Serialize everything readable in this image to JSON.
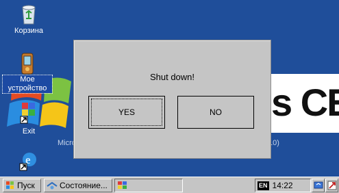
{
  "desktop": {
    "icons": [
      {
        "label": "Корзина"
      },
      {
        "label": "Мое устройство"
      },
      {
        "label": "Exit"
      },
      {
        "label": ""
      }
    ],
    "wallpaper": {
      "ce_text": "s CE",
      "ms_text": "Micro",
      "ms_tail": "10)"
    }
  },
  "dialog": {
    "message": "Shut down!",
    "yes_label": "YES",
    "no_label": "NO"
  },
  "taskbar": {
    "start_label": "Пуск",
    "task1_label": "Состояние...",
    "task2_label": "",
    "lang": "EN",
    "clock": "14:22"
  },
  "colors": {
    "desktop": "#1f4e9a",
    "dialog": "#c5c5c5",
    "taskbar": "#c5c5c5"
  }
}
